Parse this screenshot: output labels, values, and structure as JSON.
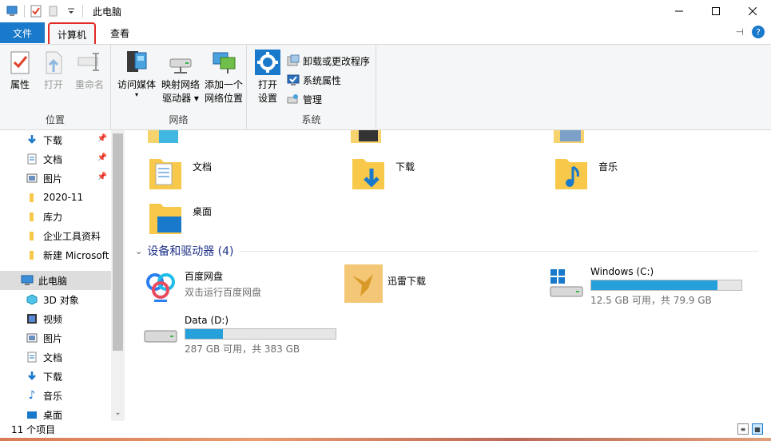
{
  "window": {
    "title": "此电脑"
  },
  "tabs": [
    {
      "label": "文件"
    },
    {
      "label": "计算机"
    },
    {
      "label": "查看"
    }
  ],
  "ribbon": {
    "groups": {
      "location": {
        "label": "位置",
        "buttons": [
          {
            "label": "属性"
          },
          {
            "label": "打开"
          },
          {
            "label": "重命名"
          }
        ]
      },
      "network": {
        "label": "网络",
        "buttons": [
          {
            "line1": "访问媒体",
            "line2": ""
          },
          {
            "line1": "映射网络",
            "line2": "驱动器"
          },
          {
            "line1": "添加一个",
            "line2": "网络位置"
          }
        ]
      },
      "system": {
        "label": "系统",
        "open_settings": {
          "line1": "打开",
          "line2": "设置"
        },
        "small": [
          {
            "label": "卸载或更改程序"
          },
          {
            "label": "系统属性"
          },
          {
            "label": "管理"
          }
        ]
      }
    }
  },
  "nav": {
    "quick": [
      {
        "label": "下载",
        "icon": "download-arrow-icon"
      },
      {
        "label": "文档",
        "icon": "document-icon"
      },
      {
        "label": "图片",
        "icon": "picture-icon"
      },
      {
        "label": "2020-11",
        "icon": "folder-icon"
      },
      {
        "label": "库力",
        "icon": "folder-icon"
      },
      {
        "label": "企业工具资料",
        "icon": "folder-icon"
      },
      {
        "label": "新建 Microsoft",
        "icon": "folder-icon"
      }
    ],
    "this_pc": {
      "label": "此电脑"
    },
    "pc_children": [
      {
        "label": "3D 对象"
      },
      {
        "label": "视频"
      },
      {
        "label": "图片"
      },
      {
        "label": "文档"
      },
      {
        "label": "下载"
      },
      {
        "label": "音乐"
      },
      {
        "label": "桌面"
      }
    ]
  },
  "folders": [
    {
      "name": "文档"
    },
    {
      "name": "下载"
    },
    {
      "name": "音乐"
    },
    {
      "name": "桌面"
    }
  ],
  "devices": {
    "header": "设备和驱动器 (4)",
    "items": [
      {
        "name": "百度网盘",
        "sub": "双击运行百度网盘"
      },
      {
        "name": "迅雷下载"
      },
      {
        "name": "Windows (C:)",
        "free": "12.5 GB 可用，共 79.9 GB",
        "used_fraction": 0.84
      },
      {
        "name": "Data (D:)",
        "free": "287 GB 可用，共 383 GB",
        "used_fraction": 0.25
      }
    ]
  },
  "status": {
    "count": "11 个项目"
  },
  "colors": {
    "accent": "#1979ca",
    "highlight": "#e12a25",
    "drive_bar": "#26a0da"
  }
}
